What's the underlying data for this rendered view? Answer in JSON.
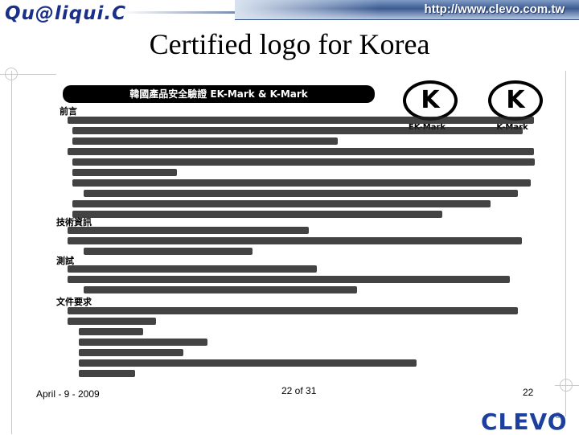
{
  "header": {
    "brand": "Qu@liqui.C",
    "url": "http://www.clevo.com.tw"
  },
  "title": "Certified logo for Korea",
  "document": {
    "heading": "韓國產品安全驗證 EK-Mark & K-Mark",
    "marks": [
      "EK-Mark",
      "K-Mark"
    ],
    "mark_glyph": "K",
    "sections": [
      "前言",
      "技術資訊",
      "測試",
      "文件要求"
    ]
  },
  "footer": {
    "date": "April - 9 - 2009",
    "page": "22 of 31",
    "slide_number": "22",
    "logo": "CLEVO",
    "logo_reg": "®"
  }
}
